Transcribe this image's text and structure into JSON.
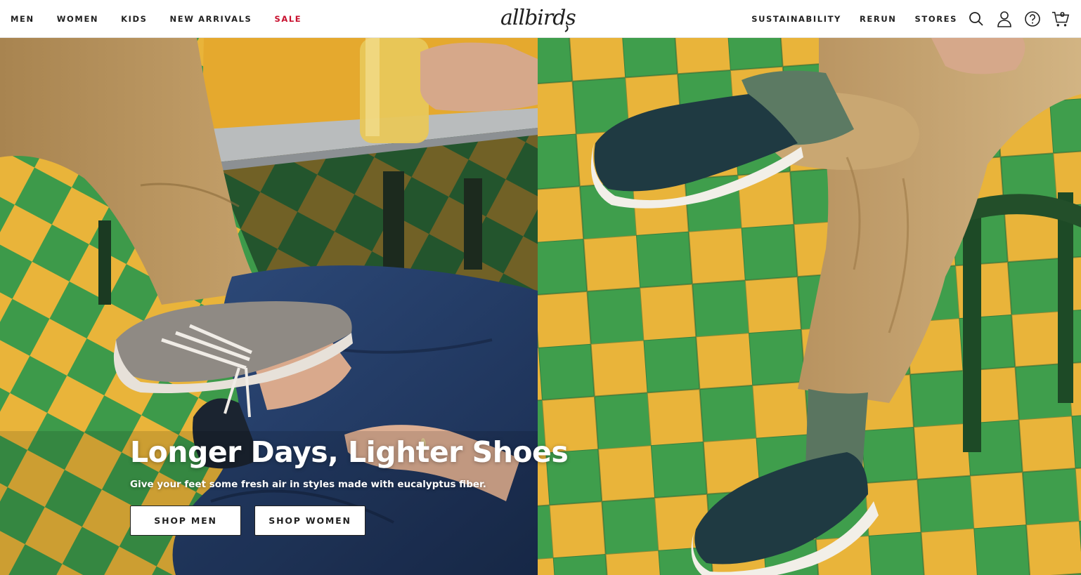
{
  "brand": {
    "logo_text": "allbirds"
  },
  "nav_left": [
    {
      "label": "MEN"
    },
    {
      "label": "WOMEN"
    },
    {
      "label": "KIDS"
    },
    {
      "label": "NEW ARRIVALS"
    },
    {
      "label": "SALE"
    }
  ],
  "nav_right": [
    {
      "label": "SUSTAINABILITY"
    },
    {
      "label": "RERUN"
    },
    {
      "label": "STORES"
    }
  ],
  "icons": {
    "search": "search-icon",
    "account": "user-icon",
    "help": "help-icon",
    "cart": "cart-icon"
  },
  "cart": {
    "count": "0"
  },
  "hero": {
    "headline": "Longer Days, Lighter Shoes",
    "subheadline": "Give your feet some fresh air in styles made with eucalyptus fiber.",
    "cta_men": "SHOP MEN",
    "cta_women": "SHOP WOMEN"
  },
  "colors": {
    "sale": "#c8102e",
    "text": "#212121",
    "tile_green": "#3d9a4a",
    "tile_yellow": "#e9b43a",
    "table_yellow": "#e5a92e",
    "denim": "#223a63",
    "khaki": "#b08b55",
    "shoe_navy": "#1f3a42"
  }
}
